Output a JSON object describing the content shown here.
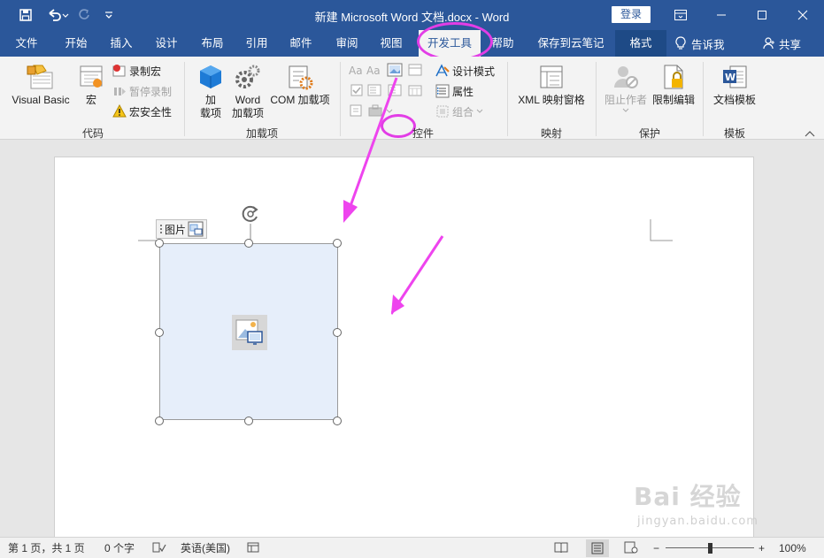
{
  "window": {
    "title": "新建 Microsoft Word 文档.docx  -  Word",
    "login_label": "登录",
    "colors": {
      "accent": "#2b579a",
      "highlight": "#e23de6"
    }
  },
  "qat": {
    "save_icon": "save-icon",
    "undo_icon": "undo-icon",
    "redo_icon": "redo-icon",
    "customize_icon": "customize-qat-icon"
  },
  "tabs": [
    {
      "label": "文件"
    },
    {
      "label": "开始"
    },
    {
      "label": "插入"
    },
    {
      "label": "设计"
    },
    {
      "label": "布局"
    },
    {
      "label": "引用"
    },
    {
      "label": "邮件"
    },
    {
      "label": "审阅"
    },
    {
      "label": "视图"
    },
    {
      "label": "开发工具",
      "active": true
    },
    {
      "label": "帮助"
    },
    {
      "label": "保存到云笔记"
    },
    {
      "label": "格式"
    }
  ],
  "tell_me": "告诉我",
  "share": "共享",
  "ribbon": {
    "code": {
      "label": "代码",
      "visual_basic": "Visual Basic",
      "macros": "宏",
      "record_macro": "录制宏",
      "pause_recording": "暂停录制",
      "macro_security": "宏安全性"
    },
    "addins": {
      "label": "加载项",
      "addins_btn": "加\n载项",
      "addins_line1": "加",
      "addins_line2": "载项",
      "word_line1": "Word",
      "word_line2": "加载项",
      "com_addins": "COM 加载项"
    },
    "controls": {
      "label": "控件",
      "design_mode": "设计模式",
      "properties": "属性",
      "group": "组合"
    },
    "mapping": {
      "label": "映射",
      "xml_pane": "XML 映射窗格"
    },
    "protect": {
      "label": "保护",
      "block_authors_line1": "阻止作者",
      "restrict_editing": "限制编辑"
    },
    "templates": {
      "label": "模板",
      "document_template": "文档模板"
    }
  },
  "document": {
    "control_tag": "图片"
  },
  "status": {
    "page": "第 1 页，共 1 页",
    "words": "0 个字",
    "language": "英语(美国)",
    "zoom": "100%",
    "zoom_minus": "−",
    "zoom_plus": "+"
  },
  "watermark": {
    "text": "Bai 经验",
    "sub": "jingyan.baidu.com"
  }
}
